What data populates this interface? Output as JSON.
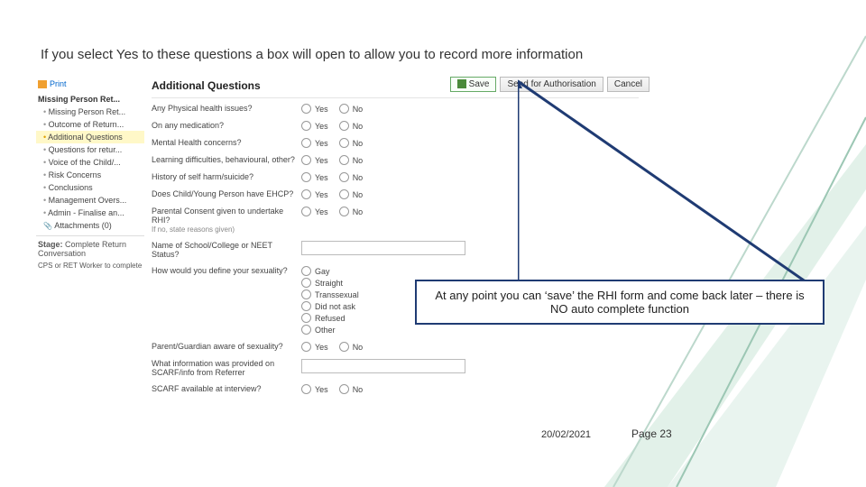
{
  "title": "If you select Yes to these questions a box will open to allow you to record more information",
  "toolbar": {
    "save": "Save",
    "send": "Send for Authorisation",
    "cancel": "Cancel"
  },
  "sidebar": {
    "print": "Print",
    "heading": "Missing Person Ret...",
    "items": [
      "Missing Person Ret...",
      "Outcome of Return...",
      "Additional Questions",
      "Questions for retur...",
      "Voice of the Child/...",
      "Risk Concerns",
      "Conclusions",
      "Management Overs...",
      "Admin - Finalise an..."
    ],
    "attachments": "Attachments (0)",
    "stage_label": "Stage:",
    "stage_value": "Complete Return Conversation",
    "stage_note": "CPS or RET Worker to complete"
  },
  "form": {
    "title": "Additional Questions",
    "q": [
      "Any Physical health issues?",
      "On any medication?",
      "Mental Health concerns?",
      "Learning difficulties, behavioural, other?",
      "History of self harm/suicide?",
      "Does Child/Young Person have EHCP?",
      "Parental Consent given to undertake RHI?",
      "Name of School/College or NEET Status?",
      "How would you define your sexuality?",
      "Parent/Guardian aware of sexuality?",
      "What information was provided on SCARF/info from Referrer",
      "SCARF available at interview?"
    ],
    "q6_sub": "If no, state reasons given)",
    "yn": [
      "Yes",
      "No"
    ],
    "sexuality": [
      "Gay",
      "Straight",
      "Transsexual",
      "Did not ask",
      "Refused",
      "Other"
    ]
  },
  "callout": "At any point you can ‘save’ the RHI form and come back later – there is NO auto complete function",
  "footer": {
    "date": "20/02/2021",
    "page": "Page 23"
  }
}
